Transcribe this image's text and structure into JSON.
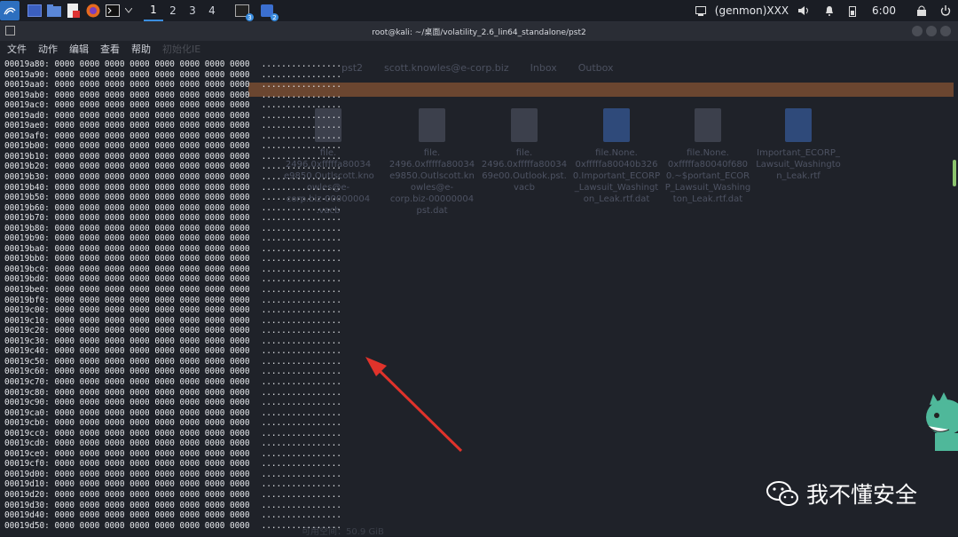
{
  "taskbar": {
    "workspaces": [
      "1",
      "2",
      "3",
      "4"
    ],
    "active_workspace": "1",
    "terminal_badge": "3",
    "dropbox_badge": "2",
    "genmon": "(genmon)XXX",
    "clock": "6:00",
    "icons": [
      "kali-menu-icon",
      "terminal-icon",
      "folder-icon",
      "text-editor-icon",
      "firefox-icon",
      "terminal-window-icon",
      "chevron-down-icon",
      "screen-icon",
      "app-icon",
      "volume-icon",
      "bell-icon",
      "battery-icon",
      "lock-icon",
      "power-icon"
    ]
  },
  "window": {
    "title": "root@kali: ~/桌面/volatility_2.6_lin64_standalone/pst2",
    "menu": [
      "文件",
      "动作",
      "编辑",
      "查看",
      "帮助"
    ],
    "menu_faded": "初始化IE"
  },
  "background_app": {
    "tabs": [
      "pst2",
      "scott.knowles@e-corp.biz",
      "Inbox",
      "Outbox"
    ],
    "files": [
      {
        "label": "file.\n2496.0xfffffa80034\ne9850.Outlscott.kno\nowles@e-\ncorp.biz-00000004\n.vacb"
      },
      {
        "label": "file.\n2496.0xfffffa80034\ne9850.Outlscott.kn\nowles@e-\ncorp.biz-00000004\npst.dat"
      },
      {
        "label": "file.\n2496.0xfffffa80034\n69e00.Outlook.pst.\nvacb"
      },
      {
        "label": "file.None.\n0xfffffa80040b326\n0.Important_ECORP\n_Lawsuit_Washingt\non_Leak.rtf.dat"
      },
      {
        "label": "file.None.\n0xfffffa80040f680\n0.~$portant_ECOR\nP_Lawsuit_Washing\nton_Leak.rtf.dat"
      },
      {
        "label": "Important_ECORP_\nLawsuit_Washingto\nn_Leak.rtf"
      }
    ],
    "status": "可用空间：50.9 GiB"
  },
  "hexdump": {
    "offsets": [
      "00019a80",
      "00019a90",
      "00019aa0",
      "00019ab0",
      "00019ac0",
      "00019ad0",
      "00019ae0",
      "00019af0",
      "00019b00",
      "00019b10",
      "00019b20",
      "00019b30",
      "00019b40",
      "00019b50",
      "00019b60",
      "00019b70",
      "00019b80",
      "00019b90",
      "00019ba0",
      "00019bb0",
      "00019bc0",
      "00019bd0",
      "00019be0",
      "00019bf0",
      "00019c00",
      "00019c10",
      "00019c20",
      "00019c30",
      "00019c40",
      "00019c50",
      "00019c60",
      "00019c70",
      "00019c80",
      "00019c90",
      "00019ca0",
      "00019cb0",
      "00019cc0",
      "00019cd0",
      "00019ce0",
      "00019cf0",
      "00019d00",
      "00019d10",
      "00019d20",
      "00019d30",
      "00019d40",
      "00019d50"
    ],
    "hex_bytes": "0000 0000 0000 0000 0000 0000 0000 0000",
    "ascii": "................"
  },
  "watermark": {
    "text": "我不懂安全"
  },
  "colors": {
    "arrow": "#e0332b",
    "highlight_row": "#6b4630"
  }
}
